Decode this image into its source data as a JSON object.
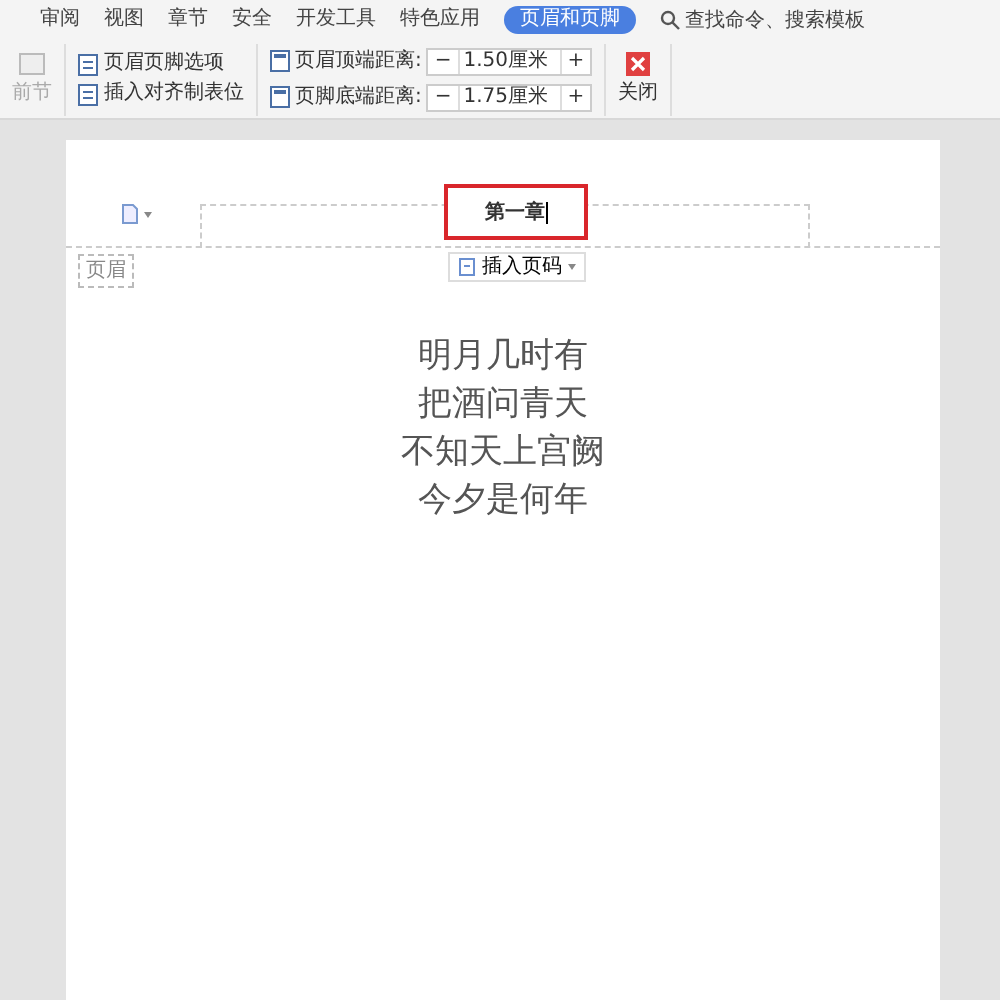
{
  "tabs": [
    {
      "label": "审阅",
      "selected": false
    },
    {
      "label": "视图",
      "selected": false
    },
    {
      "label": "章节",
      "selected": false
    },
    {
      "label": "安全",
      "selected": false
    },
    {
      "label": "开发工具",
      "selected": false
    },
    {
      "label": "特色应用",
      "selected": false
    },
    {
      "label": "页眉和页脚",
      "selected": true
    }
  ],
  "search": {
    "text": "查找命令、搜索模板"
  },
  "toolbar": {
    "section_button": {
      "label": "前节",
      "disabled": true
    },
    "options": [
      "页眉页脚选项",
      "插入对齐制表位"
    ],
    "spacings": [
      {
        "label": "页眉顶端距离:",
        "decrement": "−",
        "value": "1.50厘米",
        "increment": "+"
      },
      {
        "label": "页脚底端距离:",
        "decrement": "−",
        "value": "1.75厘米",
        "increment": "+"
      }
    ],
    "close": "关闭"
  },
  "document": {
    "header": {
      "text": "第一章",
      "highlighted": true,
      "tag": "页眉",
      "insert_page_number": "插入页码"
    },
    "body": [
      "明月几时有",
      "把酒问青天",
      "不知天上宫阙",
      "今夕是何年"
    ]
  }
}
